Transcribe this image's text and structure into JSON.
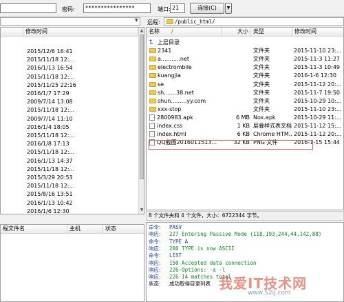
{
  "topbar": {
    "host_value": "",
    "password_label": "密码:",
    "password_value": "****************",
    "port_label": "端口:",
    "port_value": "21",
    "connect_label": "连接(C)",
    "dropdown_glyph": "▼"
  },
  "left": {
    "col_modified": "修改时间",
    "dates": [
      "2015/12/6 16:41",
      "2015/11/18 12:...",
      "2016/1/13 16:54",
      "2015/11/18 12:...",
      "2015/11/25 22:16",
      "2016/1/7 17:29",
      "2009/7/14 13:08",
      "2015/11/18 12:...",
      "2009/7/14 11:10",
      "2016/1/4 18:05",
      "2015/11/18 12:...",
      "2016/1/8 17:13",
      "2015/11/18 12:...",
      "2016/1/13 14:37",
      "2015/11/18 12:...",
      "2015/3/29 20:53",
      "2015/11/18 12:...",
      "2015/8/16 13:51",
      "2016/1/13 10:42",
      "2016/1/6 12:30"
    ]
  },
  "queue": {
    "col_local": "程文件名",
    "col_host": "主机",
    "col_status": "状态"
  },
  "right": {
    "path_label": "远程:",
    "path_value": "/public_html/",
    "col_name": "名称",
    "sort_glyph": "/",
    "col_size": "大小",
    "col_type": "类型",
    "col_modified": "修改时间",
    "rows": [
      {
        "icon": "up",
        "name": "上层目录",
        "size": "",
        "type": "",
        "date": ""
      },
      {
        "icon": "folder",
        "name": "2341",
        "size": "",
        "type": "文件夹",
        "date": "2015-11-10 23:..."
      },
      {
        "icon": "folder",
        "name": "a...........net",
        "size": "",
        "type": "文件夹",
        "date": "2015-11-3 11:27"
      },
      {
        "icon": "folder",
        "name": "electrombile",
        "size": "",
        "type": "文件夹",
        "date": "2015-11-3 10:49"
      },
      {
        "icon": "folder",
        "name": "kuangjia",
        "size": "",
        "type": "文件夹",
        "date": "2016-1-6 12:30"
      },
      {
        "icon": "folder",
        "name": "se",
        "size": "",
        "type": "文件夹",
        "date": "2015-11-12 20:..."
      },
      {
        "icon": "folder",
        "name": "sh.......38.net",
        "size": "",
        "type": "文件夹",
        "date": "2015-11-7 19:50"
      },
      {
        "icon": "folder",
        "name": "shun.........yy.com",
        "size": "",
        "type": "文件夹",
        "date": "2015-10-29 10:..."
      },
      {
        "icon": "folder",
        "name": "xxx-stop",
        "size": "",
        "type": "文件夹",
        "date": "2015-11-10 23:..."
      },
      {
        "icon": "file",
        "name": "2800983.apk",
        "size": "6 MB",
        "type": "Nox.apk",
        "date": "2015-10-29 11:..."
      },
      {
        "icon": "file",
        "name": "index.css",
        "size": "1 KB",
        "type": "层叠样式表文档",
        "date": "2015-11-12 15:..."
      },
      {
        "icon": "file",
        "name": "index.html",
        "size": "6 KB",
        "type": "Chrome HTM...",
        "date": "2015-11-12 20:..."
      },
      {
        "icon": "file",
        "name": "QQ截图2016011513...",
        "size": "32 KB",
        "type": "PNG 文件",
        "date": "2016-1-15 15:44"
      }
    ],
    "status_text": "8 个文件夹和 4 个文件，大小：6722344 字节。"
  },
  "log": [
    {
      "kind": "cmd",
      "label": "命令:",
      "text": "PASV"
    },
    {
      "kind": "resp",
      "label": "响应:",
      "text": "227 Entering Passive Mode (118,193,244,44,142,88)"
    },
    {
      "kind": "cmd",
      "label": "命令:",
      "text": "TYPE A"
    },
    {
      "kind": "resp",
      "label": "响应:",
      "text": "200 TYPE is now ASCII"
    },
    {
      "kind": "cmd",
      "label": "命令:",
      "text": "LIST"
    },
    {
      "kind": "resp",
      "label": "响应:",
      "text": "150 Accepted data connection"
    },
    {
      "kind": "resp",
      "label": "响应:",
      "text": "226-Options: -a -l"
    },
    {
      "kind": "resp",
      "label": "响应:",
      "text": "226 14 matches total"
    },
    {
      "kind": "status",
      "label": "状态:",
      "text": "成功取得目录列表"
    }
  ],
  "watermark": {
    "text": "我爱IT技术网",
    "url": "www.52ij.com"
  },
  "colors": {
    "accent": "#1a3aa8",
    "response": "#0f8a1e",
    "highlight": "#e06060"
  }
}
